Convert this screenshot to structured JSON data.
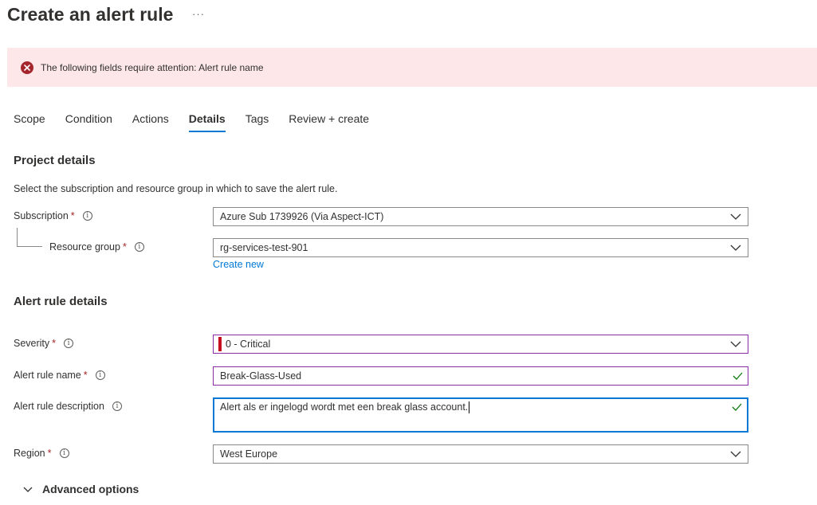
{
  "header": {
    "title": "Create an alert rule",
    "more_label": "···"
  },
  "banner": {
    "message": "The following fields require attention: Alert rule name"
  },
  "tabs": [
    {
      "label": "Scope"
    },
    {
      "label": "Condition"
    },
    {
      "label": "Actions"
    },
    {
      "label": "Details",
      "active": true
    },
    {
      "label": "Tags"
    },
    {
      "label": "Review + create"
    }
  ],
  "project": {
    "title": "Project details",
    "description": "Select the subscription and resource group in which to save the alert rule.",
    "subscription_label": "Subscription",
    "subscription_value": "Azure Sub 1739926 (Via Aspect-ICT)",
    "resource_group_label": "Resource group",
    "resource_group_value": "rg-services-test-901",
    "create_new": "Create new"
  },
  "alert": {
    "title": "Alert rule details",
    "severity_label": "Severity",
    "severity_value": "0 - Critical",
    "name_label": "Alert rule name",
    "name_value": "Break-Glass-Used",
    "description_label": "Alert rule description",
    "description_value": "Alert als er ingelogd wordt met een break glass account.",
    "region_label": "Region",
    "region_value": "West Europe",
    "advanced_label": "Advanced options"
  },
  "common": {
    "required_mark": "*",
    "info_glyph": "i"
  },
  "colors": {
    "accent": "#0078d4",
    "error": "#a4262c",
    "severity_critical": "#c50f1f",
    "valid_check": "#107c10",
    "banner_bg": "#fde7e9"
  }
}
